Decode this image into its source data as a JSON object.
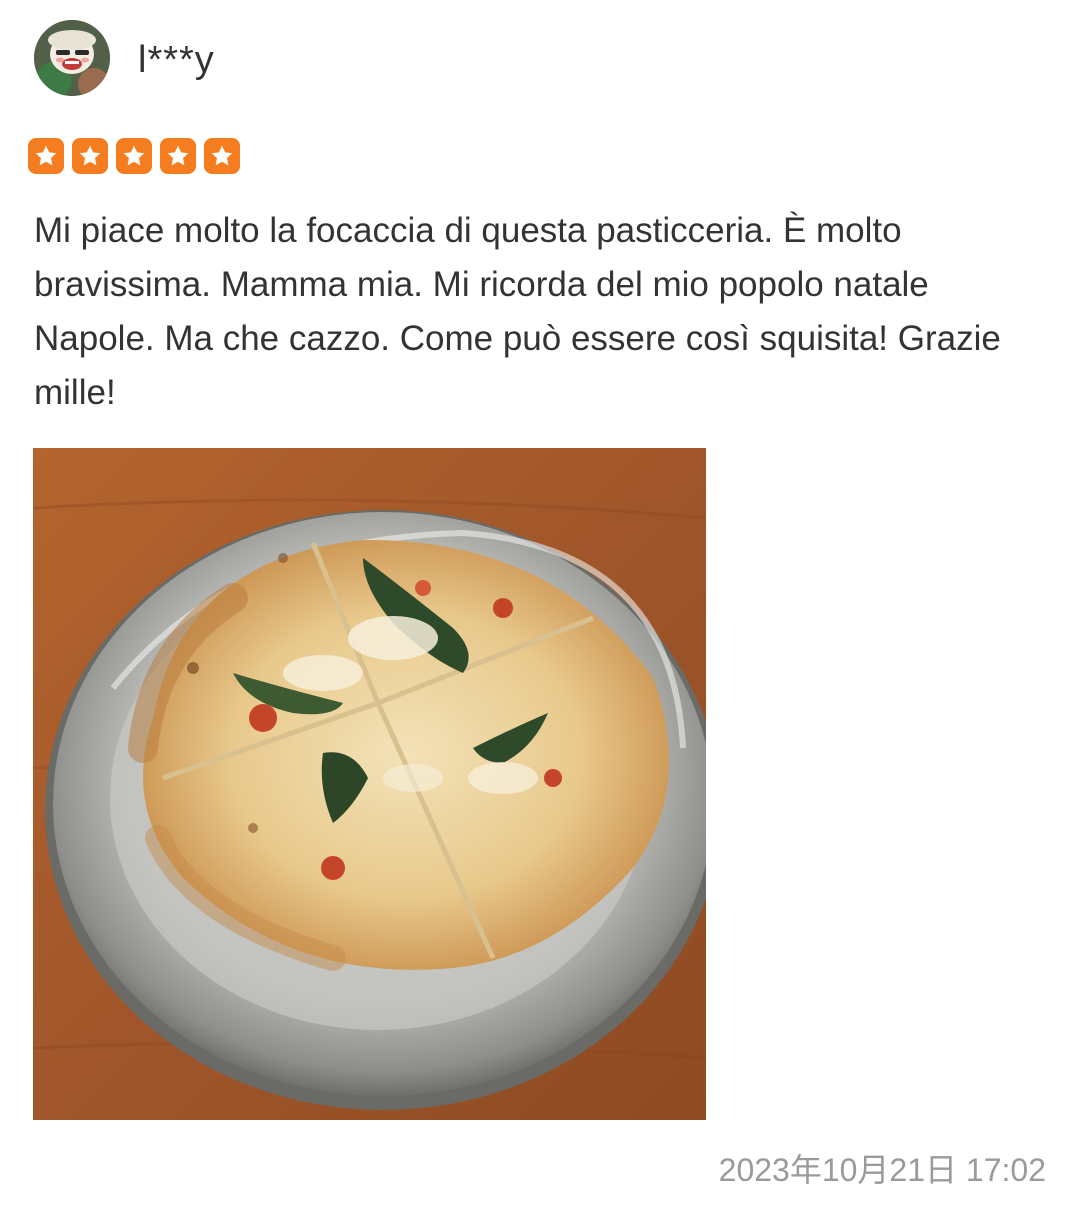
{
  "review": {
    "user": {
      "name": "l***y",
      "avatar_icon": "user-avatar"
    },
    "rating": {
      "value": 5,
      "max": 5,
      "star_color": "#f57c1f"
    },
    "text": "Mi piace molto la focaccia di questa pasticceria. È molto bravissima. Mamma mia. Mi ricorda del mio popolo natale Napole. Ma che cazzo. Come può essere così squisita! Grazie mille!",
    "photo_icon": "focaccia-photo",
    "timestamp": "2023年10月21日 17:02"
  }
}
